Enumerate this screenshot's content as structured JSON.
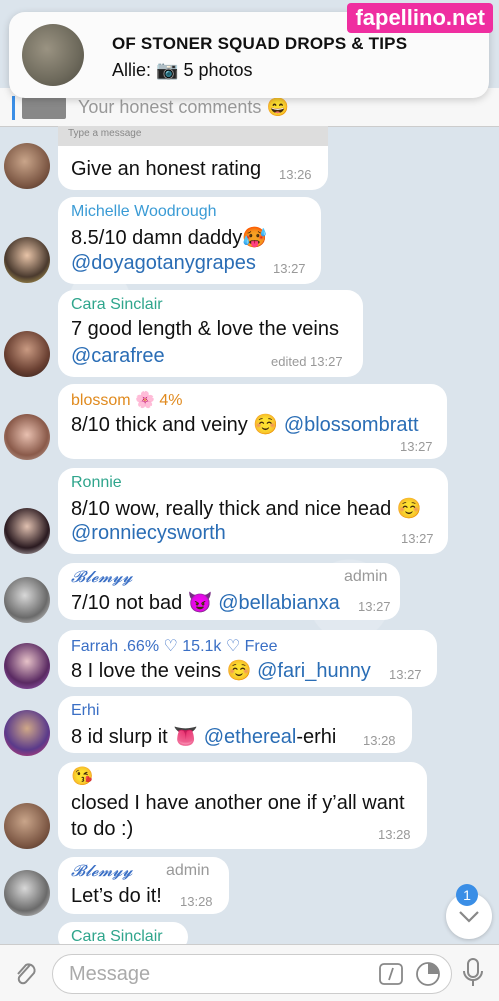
{
  "watermark": "fapellino.net",
  "notification": {
    "title": "OF STONER SQUAD DROPS & TIPS",
    "sender": "Allie:",
    "camera_icon": "camera-icon",
    "body": "5 photos"
  },
  "pinned": {
    "text": "Your honest comments 😄"
  },
  "message_box": {
    "placeholder": "Type a message"
  },
  "messages": [
    {
      "text": "Give an honest rating",
      "time": "13:26"
    },
    {
      "name": "Michelle Woodrough",
      "name_color": "#3a9bd5",
      "line1": "8.5/10 damn daddy🥵",
      "handle": "@doyagotanygrapes",
      "time": "13:27"
    },
    {
      "name": "Cara Sinclair",
      "name_color": "#2fa58c",
      "line1": "7 good length & love the veins",
      "handle": "@carafree",
      "time": "edited 13:27"
    },
    {
      "name": "blossom 🌸 4%",
      "name_color": "#e08a1e",
      "line1": "8/10 thick and veiny ☺️",
      "handle": "@blossombratt",
      "time": "13:27"
    },
    {
      "name": "Ronnie",
      "name_color": "#2fa58c",
      "line1": "8/10 wow, really thick and nice head ☺️",
      "handle": "@ronniecysworth",
      "time": "13:27"
    },
    {
      "name": "𝓑𝓵𝓮𝓶𝔂𝔂",
      "name_color": "#3a6fc5",
      "role": "admin",
      "line1": "7/10 not bad 😈",
      "handle": "@bellabianxa",
      "time": "13:27"
    },
    {
      "name": "Farrah .66% ♡ 15.1k ♡ Free",
      "name_color": "#3a6fc5",
      "line1": "8 I love the veins ☺️",
      "handle": "@fari_hunny",
      "time": "13:27"
    },
    {
      "name": "Erhi",
      "name_color": "#3a6fc5",
      "line1": "8 id slurp it 👅",
      "handle": "@ethereal",
      "handle_rest": "-erhi",
      "time": "13:28"
    },
    {
      "line0": "😘",
      "line1": "closed I have another one if y’all want",
      "line2": "to do :)",
      "time": "13:28"
    },
    {
      "name": "𝓑𝓵𝓮𝓶𝔂𝔂",
      "name_color": "#3a6fc5",
      "role": "admin",
      "line1": "Let’s do it!",
      "time": "13:28"
    },
    {
      "name": "Cara Sinclair",
      "name_color": "#2fa58c"
    }
  ],
  "input": {
    "placeholder": "Message"
  },
  "unread_badge": "1",
  "icons": {
    "attach": "paperclip-icon",
    "command": "slash-command-icon",
    "sticker": "sticker-icon",
    "mic": "microphone-icon",
    "scroll": "chevron-down-icon"
  }
}
